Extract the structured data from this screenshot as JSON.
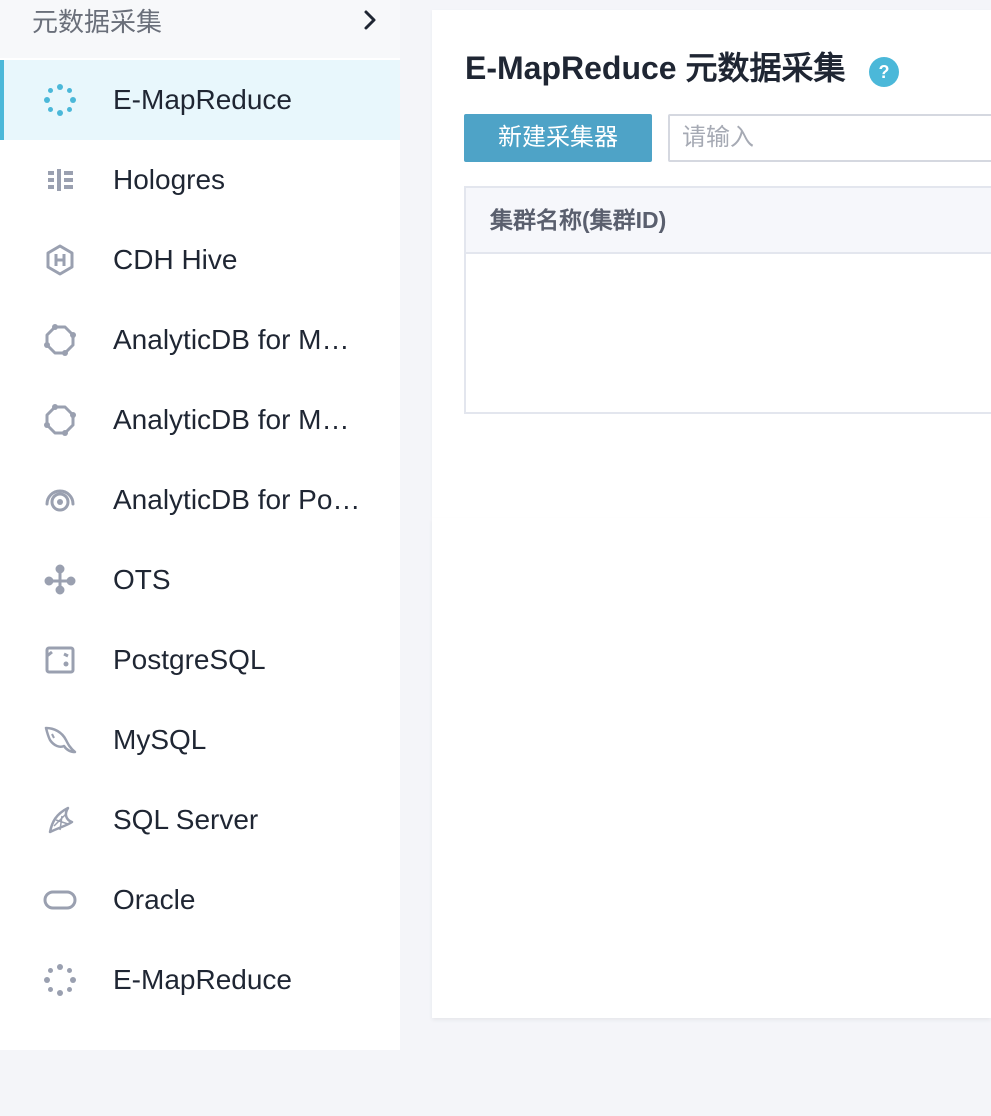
{
  "sidebar": {
    "title": "元数据采集",
    "items": [
      {
        "label": "E-MapReduce",
        "icon": "emapreduce-icon",
        "active": true
      },
      {
        "label": "Hologres",
        "icon": "hologres-icon"
      },
      {
        "label": "CDH Hive",
        "icon": "cdh-hive-icon"
      },
      {
        "label": "AnalyticDB for M…",
        "icon": "analyticdb-icon"
      },
      {
        "label": "AnalyticDB for M…",
        "icon": "analyticdb-icon"
      },
      {
        "label": "AnalyticDB for Po…",
        "icon": "analyticdb-postgresql-icon"
      },
      {
        "label": "OTS",
        "icon": "ots-icon"
      },
      {
        "label": "PostgreSQL",
        "icon": "postgresql-icon"
      },
      {
        "label": "MySQL",
        "icon": "mysql-icon"
      },
      {
        "label": "SQL Server",
        "icon": "sql-server-icon"
      },
      {
        "label": "Oracle",
        "icon": "oracle-icon"
      },
      {
        "label": "E-MapReduce",
        "icon": "emapreduce-icon"
      }
    ]
  },
  "main": {
    "title": "E-MapReduce 元数据采集",
    "create_label": "新建采集器",
    "search_placeholder": "请输入",
    "table": {
      "columns": [
        "集群名称(集群ID)"
      ],
      "rows": []
    }
  },
  "colors": {
    "accent": "#4ea3c7",
    "active_bg": "#e8f7fc",
    "active_icon": "#4bb8d9",
    "icon_gray": "#9aa0b0"
  }
}
